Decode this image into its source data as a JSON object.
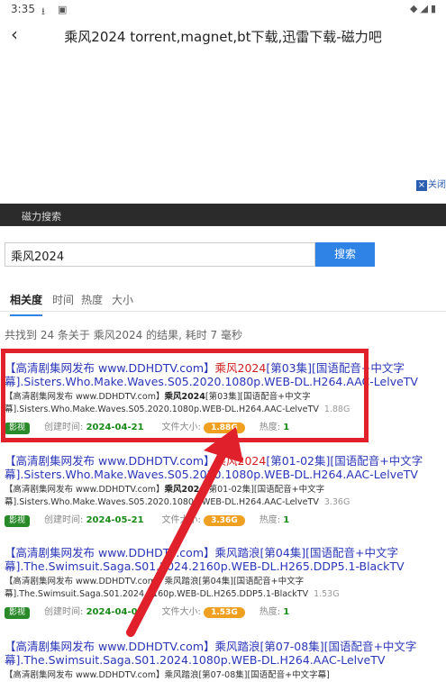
{
  "status_bar": {
    "time": "3:35",
    "icons": [
      "download-icon",
      "image-icon"
    ],
    "right_icons": [
      "wifi-icon",
      "signal-icon",
      "battery-icon"
    ]
  },
  "app_bar": {
    "back_icon": "back-arrow-icon",
    "title": "乘风2024 torrent,magnet,bt下载,迅雷下载-磁力吧"
  },
  "ad": {
    "close_label": "关闭"
  },
  "top_nav": {
    "label": "磁力搜索"
  },
  "search": {
    "value": "乘风2024",
    "button_label": "搜索"
  },
  "tabs": [
    {
      "label": "相关度",
      "active": true
    },
    {
      "label": "时间",
      "active": false
    },
    {
      "label": "热度",
      "active": false
    },
    {
      "label": "大小",
      "active": false
    }
  ],
  "summary": "共找到 24 条关于 乘风2024 的结果, 耗时 7 毫秒",
  "meta_labels": {
    "created": "创建时间:",
    "filesize": "文件大小:",
    "heat": "热度:"
  },
  "results": [
    {
      "title_pre": "【高清剧集网发布 www.DDHDTV.com】",
      "title_hl": "乘风2024",
      "title_post": "[第03集][国语配音+中文字幕].Sisters.Who.Make.Waves.S05.2020.1080p.WEB-DL.H264.AAC-LelveTV",
      "desc_pre": "【高清剧集网发布 www.DDHDTV.com】",
      "desc_bold": "乘风2024",
      "desc_post": "[第03集][国语配音+中文字幕].Sisters.Who.Make.Waves.S05.2020.1080p.WEB-DL.H264.AAC-LelveTV",
      "desc_size": "1.88G",
      "badge": "影视",
      "date": "2024-04-21",
      "size": "1.88G",
      "heat": "1"
    },
    {
      "title_pre": "【高清剧集网发布 www.DDHDTV.com】",
      "title_hl": "乘风2024",
      "title_post": "[第01-02集][国语配音+中文字幕].Sisters.Who.Make.Waves.S05.2020.1080p.WEB-DL.H264.AAC-LelveTV",
      "desc_pre": "【高清剧集网发布 www.DDHDTV.com】",
      "desc_bold": "乘风2024",
      "desc_post": "[第01-02集][国语配音+中文字幕].Sisters.Who.Make.Waves.S05.2020.1080p.WEB-DL.H264.AAC-LelveTV",
      "desc_size": "3.36G",
      "badge": "影视",
      "date": "2024-05-21",
      "size": "3.36G",
      "heat": "1"
    },
    {
      "title_pre": "【高清剧集网发布 www.DDHDTV.com】",
      "title_hl": "",
      "title_post": "乘风踏浪[第04集][国语配音+中文字幕].The.Swimsuit.Saga.S01.2024.2160p.WEB-DL.H265.DDP5.1-BlackTV",
      "desc_pre": "【高清剧集网发布 www.DDHDTV.com】",
      "desc_bold": "",
      "desc_post": "乘风踏浪[第04集][国语配音+中文字幕].The.Swimsuit.Saga.S01.2024.2160p.WEB-DL.H265.DDP5.1-BlackTV",
      "desc_size": "1.53G",
      "badge": "影视",
      "date": "2024-04-01",
      "size": "1.53G",
      "heat": "1"
    },
    {
      "title_pre": "【高清剧集网发布 www.DDHDTV.com】",
      "title_hl": "",
      "title_post": "乘风踏浪[第07-08集][国语配音+中文字幕].The.Swimsuit.Saga.S01.2024.1080p.WEB-DL.H264.AAC-LelveTV",
      "desc_pre": "【高清剧集网发布 www.DDHDTV.com】",
      "desc_bold": "",
      "desc_post": "乘风踏浪[第07-08集][国语配音+中文字幕]"
    }
  ],
  "annotation": {
    "box_color": "#e0202a",
    "arrow_color": "#e0202a"
  }
}
